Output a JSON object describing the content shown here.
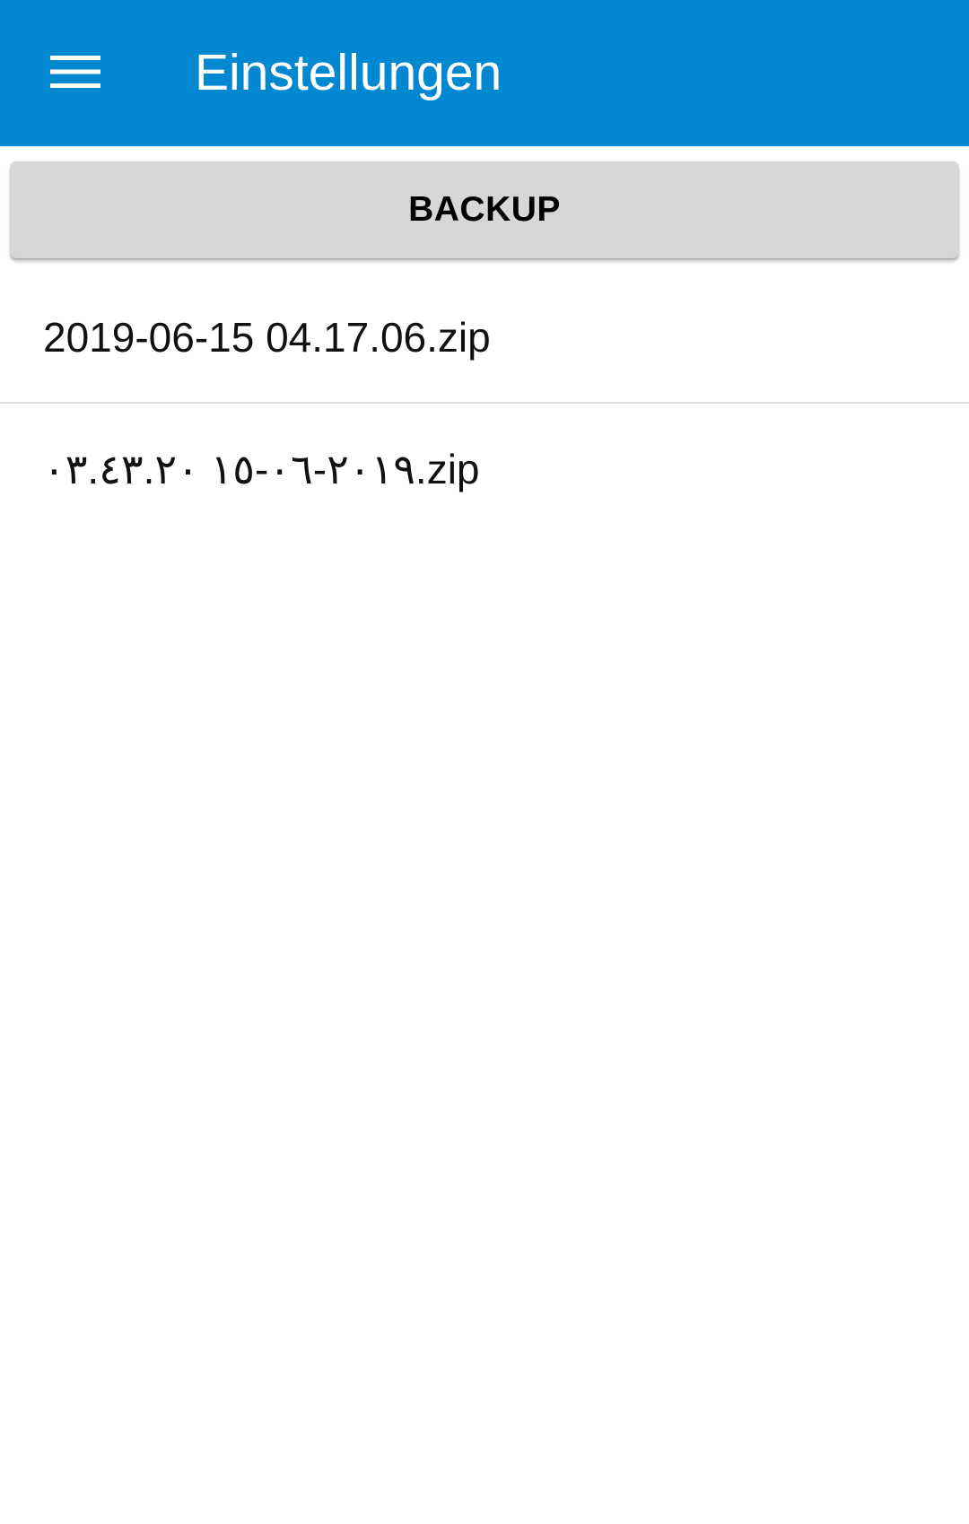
{
  "app_bar": {
    "title": "Einstellungen",
    "menu_icon": "hamburger-menu-icon",
    "background_color": "#0288D1"
  },
  "backup": {
    "label": "BACKUP",
    "background_color": "#D6D7D7"
  },
  "files": [
    {
      "name": "2019-06-15 04.17.06.zip"
    },
    {
      "name": "٢٠١٩-٠٦-١٥ ٠٣.٤٣.٢٠.zip"
    }
  ]
}
